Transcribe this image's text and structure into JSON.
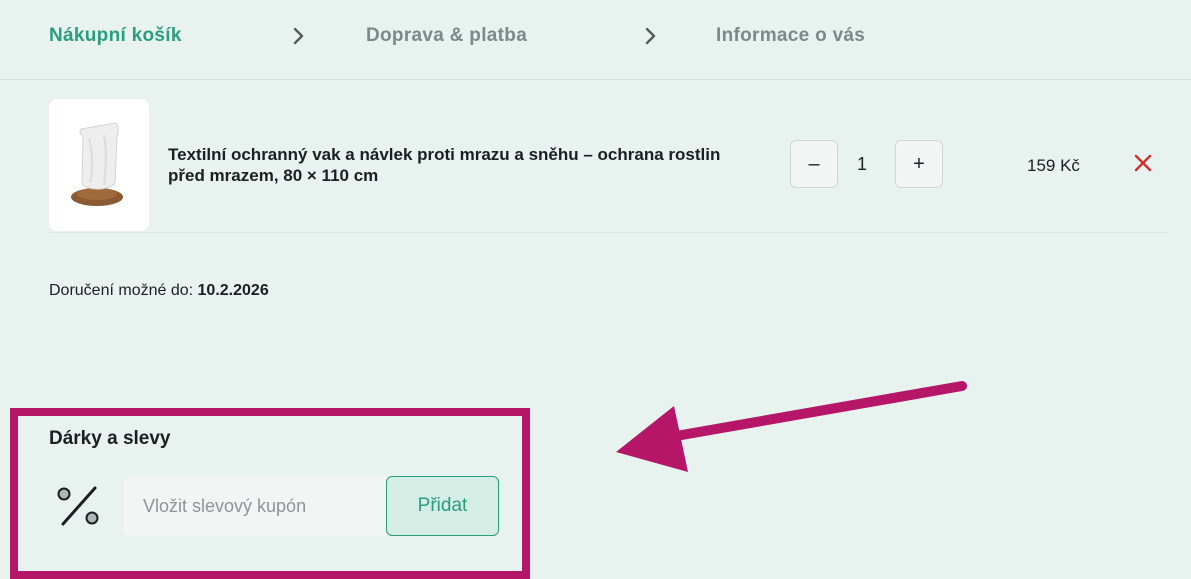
{
  "steps": [
    {
      "label": "Nákupní košík",
      "active": true
    },
    {
      "label": "Doprava & platba",
      "active": false
    },
    {
      "label": "Informace o vás",
      "active": false
    }
  ],
  "cart": {
    "item": {
      "title": "Textilní ochranný vak a návlek proti mrazu a sněhu – ochrana rostlin před mrazem, 80 × 110 cm",
      "quantity": "1",
      "minus_label": "–",
      "plus_label": "+",
      "price": "159 Kč",
      "remove_icon": "close-icon"
    },
    "delivery_label": "Doručení možné do:",
    "delivery_date": "10.2.2026"
  },
  "gifts": {
    "title": "Dárky a slevy",
    "icon": "percent-icon",
    "coupon_placeholder": "Vložit slevový kupón",
    "add_label": "Přidat"
  },
  "colors": {
    "background": "#e8f3ef",
    "accent": "#2a9d7f",
    "highlight": "#b51668",
    "remove": "#d32f2f"
  }
}
